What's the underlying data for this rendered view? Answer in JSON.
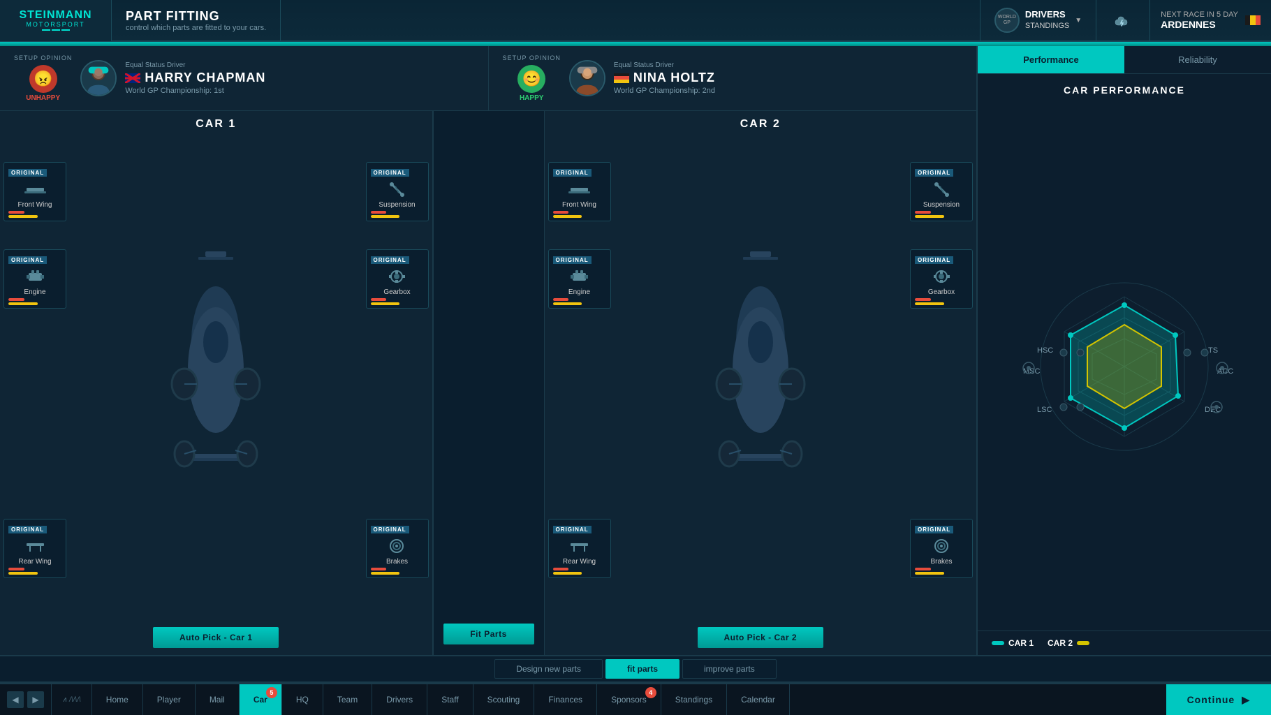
{
  "app": {
    "logo_line1": "STEINMANN",
    "logo_line2": "MOTORSPORT",
    "title": "PART FITTING",
    "subtitle": "control which parts are fitted to your cars."
  },
  "topbar": {
    "standings_label": "DRIVERS\nSTANDINGS",
    "next_race_label": "NEXT RACE IN 5 DAY",
    "next_race_location": "ARDENNES"
  },
  "drivers": [
    {
      "setup_opinion": "SETUP OPINION",
      "role": "Equal Status Driver",
      "name": "HARRY CHAPMAN",
      "flag": "gb",
      "championship": "World GP Championship: 1st",
      "status": "UNHAPPY",
      "mood": "😠"
    },
    {
      "setup_opinion": "SETUP OPINION",
      "role": "Equal Status Driver",
      "name": "NINA HOLTZ",
      "flag": "de",
      "championship": "World GP Championship: 2nd",
      "status": "HAPPY",
      "mood": "😊"
    }
  ],
  "cars": [
    {
      "label": "CAR 1",
      "parts": [
        {
          "badge": "ORIGINAL",
          "name": "Front Wing",
          "position": "top-left",
          "icon": "🔧"
        },
        {
          "badge": "ORIGINAL",
          "name": "Suspension",
          "position": "top-right",
          "icon": "⚙️"
        },
        {
          "badge": "ORIGINAL",
          "name": "Engine",
          "position": "mid-left",
          "icon": "🔩"
        },
        {
          "badge": "ORIGINAL",
          "name": "Gearbox",
          "position": "mid-right",
          "icon": "⚙️"
        },
        {
          "badge": "ORIGINAL",
          "name": "Rear Wing",
          "position": "bot-left",
          "icon": "🔧"
        },
        {
          "badge": "ORIGINAL",
          "name": "Brakes",
          "position": "bot-right",
          "icon": "🔄"
        }
      ],
      "auto_pick_label": "Auto Pick - Car 1"
    },
    {
      "label": "CAR 2",
      "parts": [
        {
          "badge": "ORIGINAL",
          "name": "Front Wing",
          "position": "top-left",
          "icon": "🔧"
        },
        {
          "badge": "ORIGINAL",
          "name": "Suspension",
          "position": "top-right",
          "icon": "⚙️"
        },
        {
          "badge": "ORIGINAL",
          "name": "Engine",
          "position": "mid-left",
          "icon": "🔩"
        },
        {
          "badge": "ORIGINAL",
          "name": "Gearbox",
          "position": "mid-right",
          "icon": "⚙️"
        },
        {
          "badge": "ORIGINAL",
          "name": "Rear Wing",
          "position": "bot-left",
          "icon": "🔧"
        },
        {
          "badge": "ORIGINAL",
          "name": "Brakes",
          "position": "bot-right",
          "icon": "🔄"
        }
      ],
      "auto_pick_label": "Auto Pick - Car 2"
    }
  ],
  "fit_parts_btn": "Fit Parts",
  "perf_panel": {
    "tab_performance": "Performance",
    "tab_reliability": "Reliability",
    "title": "CAR PERFORMANCE",
    "labels": [
      "HSC",
      "TS",
      "MSC",
      "ACC",
      "LSC",
      "DEC"
    ],
    "legend": [
      {
        "label": "CAR 1",
        "color": "#00c8c0"
      },
      {
        "label": "CAR 2",
        "color": "#d4c400"
      }
    ]
  },
  "tabs": [
    {
      "label": "Design new parts",
      "active": false
    },
    {
      "label": "fit parts",
      "active": true
    },
    {
      "label": "improve parts",
      "active": false
    }
  ],
  "nav": {
    "items": [
      {
        "label": "Home",
        "active": false,
        "badge": null
      },
      {
        "label": "Player",
        "active": false,
        "badge": null
      },
      {
        "label": "Mail",
        "active": false,
        "badge": null
      },
      {
        "label": "Car",
        "active": true,
        "badge": "5"
      },
      {
        "label": "HQ",
        "active": false,
        "badge": null
      },
      {
        "label": "Team",
        "active": false,
        "badge": null
      },
      {
        "label": "Drivers",
        "active": false,
        "badge": null
      },
      {
        "label": "Staff",
        "active": false,
        "badge": null
      },
      {
        "label": "Scouting",
        "active": false,
        "badge": null
      },
      {
        "label": "Finances",
        "active": false,
        "badge": null
      },
      {
        "label": "Sponsors",
        "active": false,
        "badge": "4"
      },
      {
        "label": "Standings",
        "active": false,
        "badge": null
      },
      {
        "label": "Calendar",
        "active": false,
        "badge": null
      }
    ],
    "continue_label": "Continue"
  }
}
